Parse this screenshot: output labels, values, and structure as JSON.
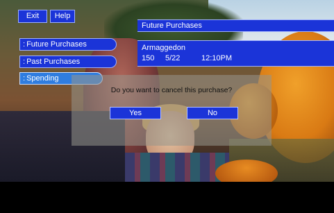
{
  "toolbar": {
    "exit_label": "Exit",
    "help_label": "Help"
  },
  "menu": {
    "items": [
      {
        "prefix": ":",
        "label": "Future Purchases"
      },
      {
        "prefix": ":",
        "label": "Past Purchases"
      },
      {
        "prefix": ":",
        "label": "Spending"
      }
    ]
  },
  "panel": {
    "header": "Future Purchases",
    "item": {
      "title": "Armaggedon",
      "channel": "150",
      "date": "5/22",
      "time": "12:10PM"
    }
  },
  "dialog": {
    "message": "Do you want to cancel this purchase?",
    "yes_label": "Yes",
    "no_label": "No"
  },
  "colors": {
    "ui_blue": "#1b34d8",
    "highlight_blue": "#2f7de0",
    "border": "#9fb0ff"
  }
}
